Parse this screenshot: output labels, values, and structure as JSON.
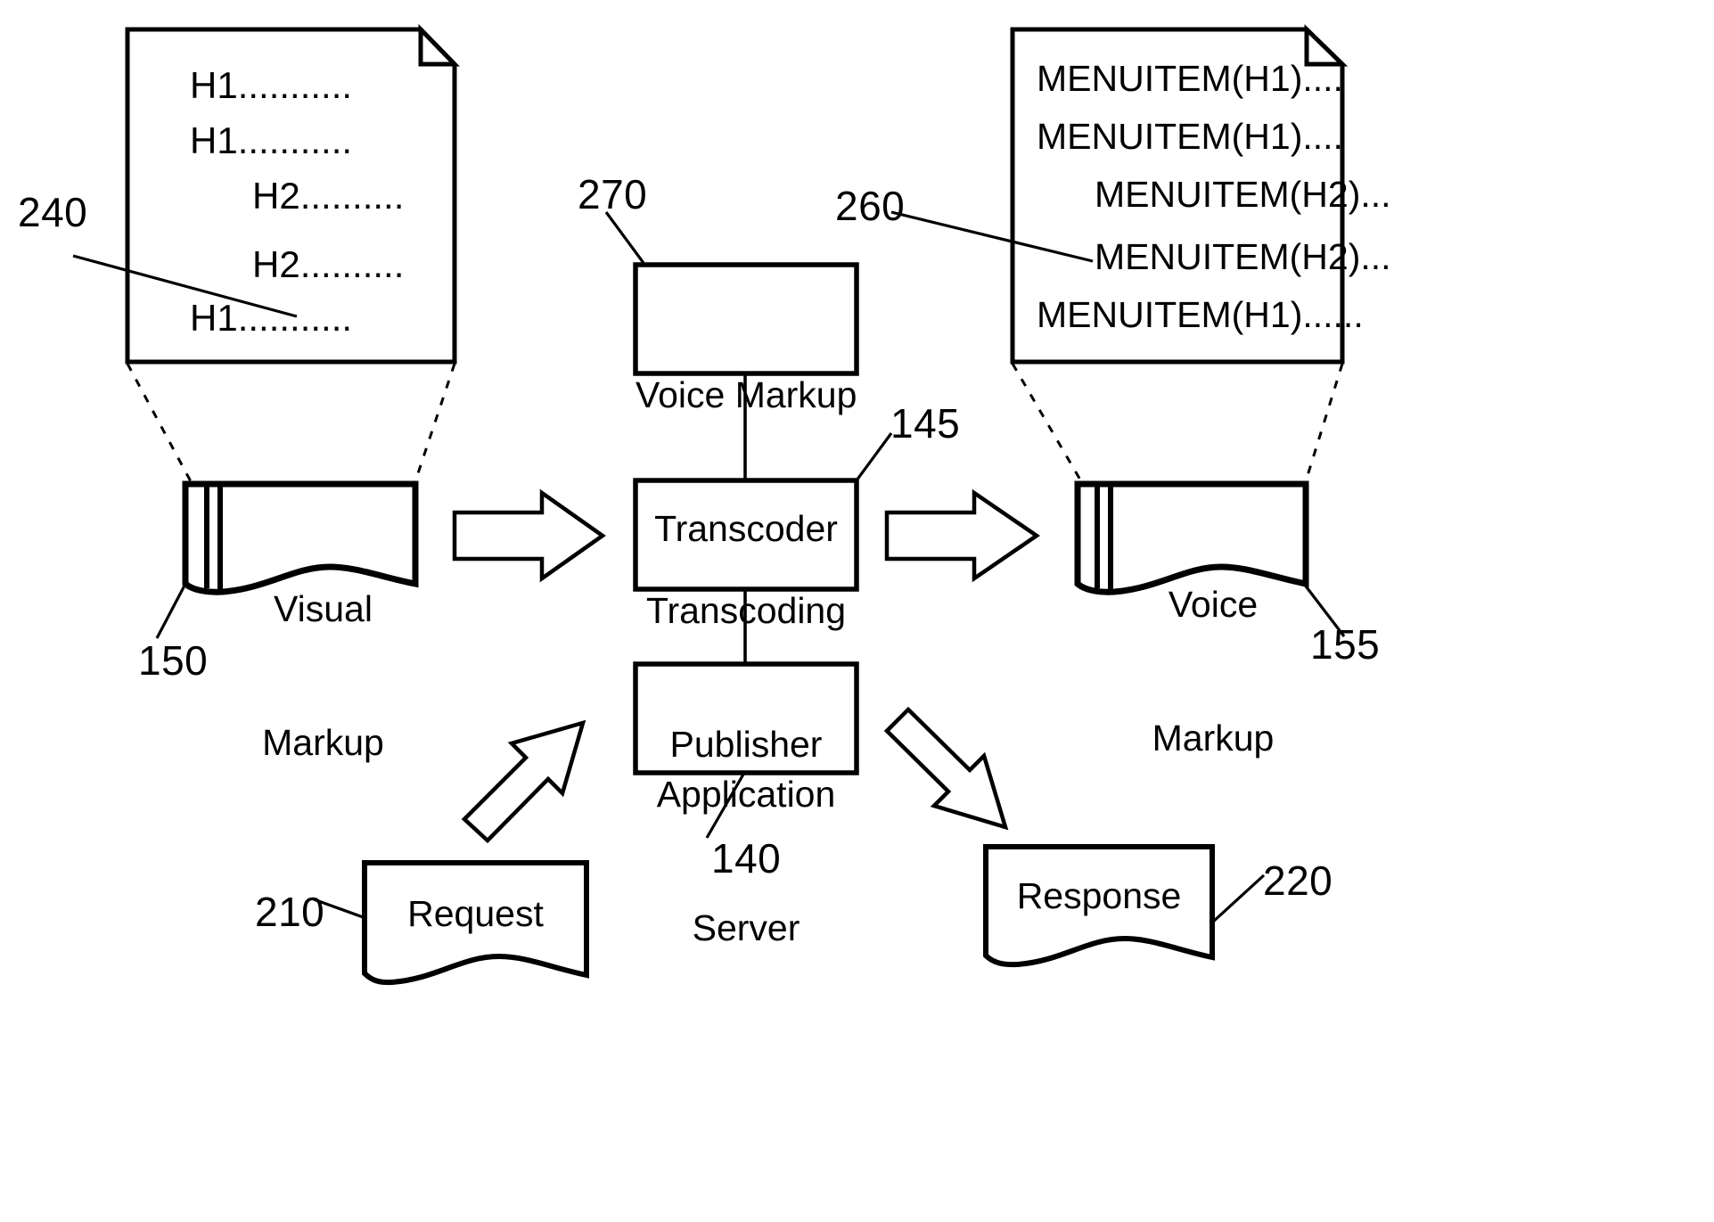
{
  "figure": {
    "type": "patent-flow-diagram",
    "background_color": "#ffffff",
    "stroke_color": "#000000"
  },
  "visual_document": {
    "name": "visual-markup-document-page",
    "lines": [
      "H1...........",
      "H1...........",
      "H2..........",
      "H2..........",
      "H1..........."
    ],
    "reference_number": "240"
  },
  "voice_document": {
    "name": "voice-markup-document-page",
    "lines": [
      "MENUITEM(H1)....",
      "MENUITEM(H1)....",
      "MENUITEM(H2)...",
      "MENUITEM(H2)...",
      "MENUITEM(H1)......"
    ],
    "reference_number": "260"
  },
  "boxes": [
    {
      "id": "voice-markup-transcoder",
      "line1": "Voice Markup",
      "line2": "Transcoder",
      "reference_number": "270"
    },
    {
      "id": "transcoding-publisher",
      "line1": "Transcoding",
      "line2": "Publisher",
      "reference_number": "145"
    },
    {
      "id": "application-server",
      "line1": "Application",
      "line2": "Server",
      "reference_number": "140"
    }
  ],
  "markup_shapes": [
    {
      "id": "visual-markup",
      "line1": "Visual",
      "line2": "Markup",
      "reference_number": "150"
    },
    {
      "id": "voice-markup",
      "line1": "Voice",
      "line2": "Markup",
      "reference_number": "155"
    }
  ],
  "message_shapes": [
    {
      "id": "request",
      "label": "Request",
      "reference_number": "210"
    },
    {
      "id": "response",
      "label": "Response",
      "reference_number": "220"
    }
  ],
  "reference_numbers": {
    "visual_doc": "240",
    "voice_doc": "260",
    "transcoder": "270",
    "publisher": "145",
    "app_server": "140",
    "visual_markup": "150",
    "voice_markup": "155",
    "request": "210",
    "response": "220"
  },
  "arrows": [
    {
      "id": "visual-markup-to-publisher",
      "direction": "right"
    },
    {
      "id": "publisher-to-voice-markup",
      "direction": "right"
    },
    {
      "id": "request-to-app-server",
      "direction": "up-right"
    },
    {
      "id": "app-server-to-response",
      "direction": "down-right"
    }
  ],
  "connectors": [
    {
      "id": "transcoder-to-publisher"
    },
    {
      "id": "publisher-to-app-server"
    },
    {
      "id": "visual-doc-callout-left"
    },
    {
      "id": "visual-doc-callout-right"
    },
    {
      "id": "voice-doc-callout-left"
    },
    {
      "id": "voice-doc-callout-right"
    }
  ]
}
